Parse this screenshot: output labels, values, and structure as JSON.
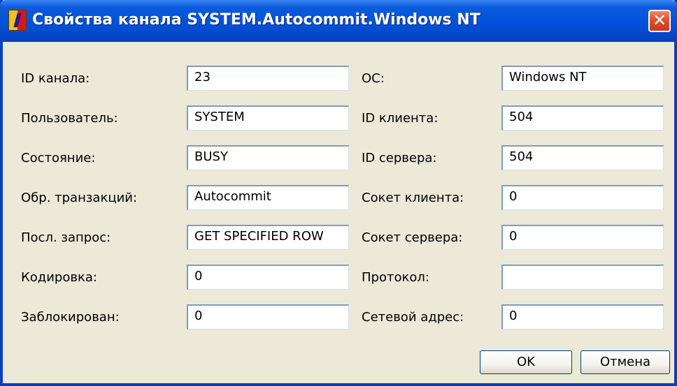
{
  "window": {
    "title": "Свойства канала SYSTEM.Autocommit.Windows NT",
    "close_label": "✕"
  },
  "left": [
    {
      "label": "ID канала:",
      "value": "23"
    },
    {
      "label": "Пользователь:",
      "value": "SYSTEM"
    },
    {
      "label": "Состояние:",
      "value": "BUSY"
    },
    {
      "label": "Обр. транзакций:",
      "value": "Autocommit"
    },
    {
      "label": "Посл. запрос:",
      "value": "GET SPECIFIED ROW"
    },
    {
      "label": "Кодировка:",
      "value": "0"
    },
    {
      "label": "Заблокирован:",
      "value": "0"
    }
  ],
  "right": [
    {
      "label": "ОС:",
      "value": "Windows NT"
    },
    {
      "label": "ID клиента:",
      "value": "504"
    },
    {
      "label": "ID сервера:",
      "value": "504"
    },
    {
      "label": "Сокет клиента:",
      "value": "0"
    },
    {
      "label": "Сокет сервера:",
      "value": "0"
    },
    {
      "label": "Протокол:",
      "value": ""
    },
    {
      "label": "Сетевой адрес:",
      "value": "0"
    }
  ],
  "buttons": {
    "ok": "OK",
    "cancel": "Отмена"
  }
}
